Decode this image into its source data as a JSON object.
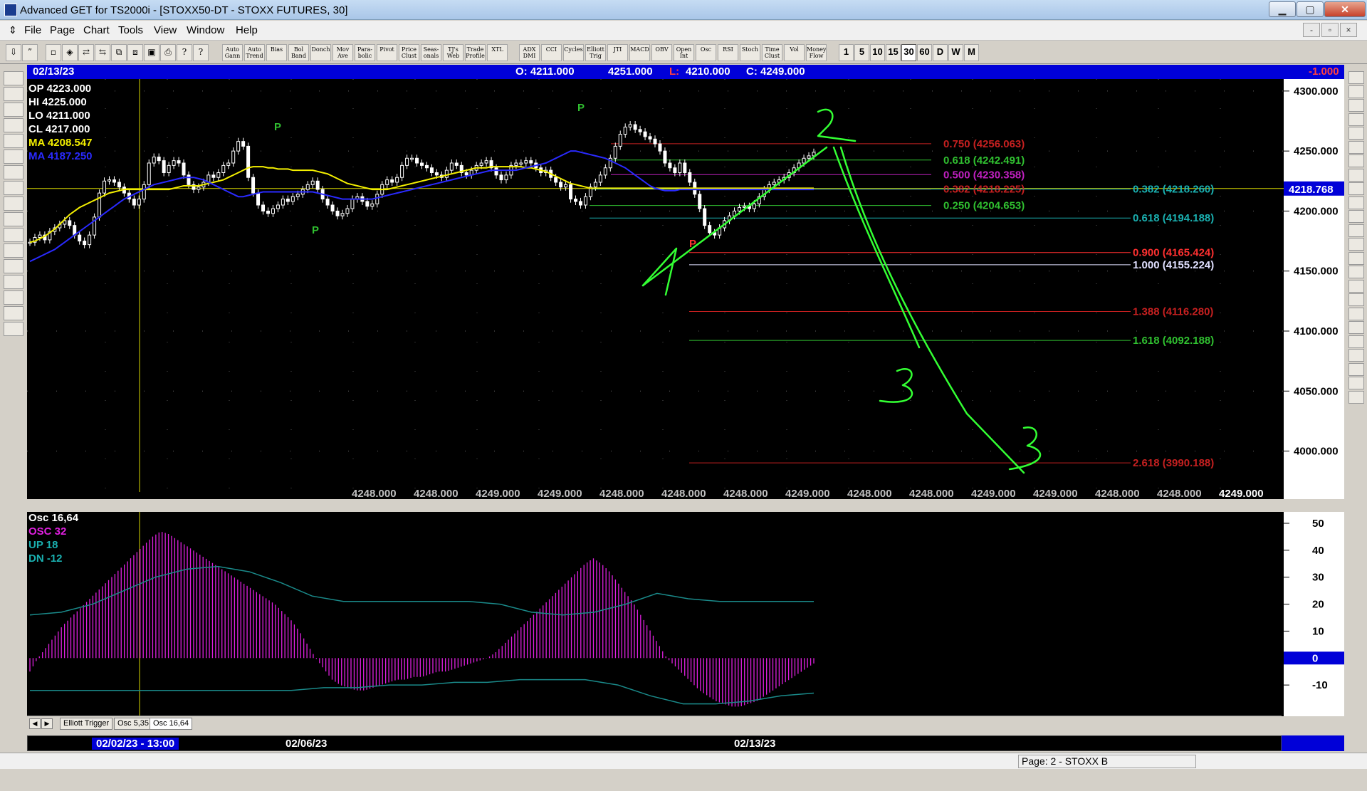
{
  "window": {
    "title": "Advanced GET for TS2000i - [STOXX50-DT - STOXX FUTURES, 30]",
    "minimize": "▁",
    "maximize": "▢",
    "close": "✕"
  },
  "menu": {
    "items": [
      "File",
      "Page",
      "Chart",
      "Tools",
      "View",
      "Window",
      "Help"
    ],
    "mdi_buttons": [
      "-",
      "▫",
      "×"
    ]
  },
  "toolbar": {
    "studies": [
      "Auto\nGann",
      "Auto\nTrend",
      "Bias",
      "Bol\nBand",
      "Donch",
      "Mov\nAve",
      "Para-\nbolic",
      "Pivot",
      "Price\nClust",
      "Seas-\nonals",
      "TJ's\nWeb",
      "Trade\nProfile",
      "XTL",
      "ADX\nDMI",
      "CCI",
      "Cycles",
      "Elliott\nTrig",
      "JTI",
      "MACD",
      "OBV",
      "Open\nInt",
      "Osc",
      "RSI",
      "Stoch",
      "Time\nClust",
      "Vol",
      "Money\nFlow"
    ],
    "timeframes": [
      "1",
      "5",
      "10",
      "15",
      "30",
      "60",
      "D",
      "W",
      "M"
    ],
    "active_timeframe": "30"
  },
  "infobar": {
    "date": "02/13/23",
    "open": "O: 4211.000",
    "high": "4251.000",
    "low_label": "L:",
    "low": "4210.000",
    "close": "C: 4249.000",
    "change": "-1.000"
  },
  "legend": {
    "op": "OP  4223.000",
    "hi": "HI   4225.000",
    "lo": "LO  4211.000",
    "cl": "CL  4217.000",
    "ma1": "MA  4208.547",
    "ma2": "MA  4187.250"
  },
  "colors": {
    "background": "#000000",
    "candle": "#ffffff",
    "ma_yellow": "#f4f000",
    "ma_blue": "#2a2aff",
    "oscillator": "#e020e0",
    "osc_band": "#1a8a8a",
    "drawing": "#33ff33",
    "accent_blue": "#0000d8"
  },
  "fib_levels": [
    {
      "label": "0.750 (4256.063)",
      "color": "#c62020",
      "price": 4256.063
    },
    {
      "label": "0.618 (4242.491)",
      "color": "#30c030",
      "price": 4242.491
    },
    {
      "label": "0.500 (4230.358)",
      "color": "#c020c0",
      "price": 4230.358
    },
    {
      "label": "0.382 (4218.225)",
      "color": "#c62020",
      "price": 4218.225
    },
    {
      "label": "0.250 (4204.653)",
      "color": "#30c030",
      "price": 4204.653
    },
    {
      "label": "0.382 (4218.260)",
      "color": "#1ab0b0",
      "price": 4218.26
    },
    {
      "label": "0.618 (4194.188)",
      "color": "#1ab0b0",
      "price": 4194.188
    },
    {
      "label": "0.900 (4165.424)",
      "color": "#ff3030",
      "price": 4165.424
    },
    {
      "label": "1.000 (4155.224)",
      "color": "#e0e0ff",
      "price": 4155.224
    },
    {
      "label": "1.388 (4116.280)",
      "color": "#c62020",
      "price": 4116.28
    },
    {
      "label": "1.618 (4092.188)",
      "color": "#30c030",
      "price": 4092.188
    },
    {
      "label": "2.618 (3990.188)",
      "color": "#c62020",
      "price": 3990.188
    }
  ],
  "price_axis": {
    "ticks": [
      "4300.000",
      "4250.000",
      "4200.000",
      "4150.000",
      "4100.000",
      "4050.000",
      "4000.000"
    ],
    "current": "4218.768"
  },
  "bottom_readout": [
    "4248.000",
    "4248.000",
    "4249.000",
    "4249.000",
    "4248.000",
    "4248.000",
    "4248.000",
    "4249.000",
    "4248.000",
    "4248.000",
    "4249.000",
    "4249.000",
    "4248.000",
    "4248.000",
    "4249.000"
  ],
  "pivot_labels": [
    "P",
    "P",
    "P",
    "P"
  ],
  "oscillator": {
    "title": "Osc 16,64",
    "osc": "OSC 32",
    "up": "UP    18",
    "dn": "DN   -12",
    "ticks": [
      "50",
      "40",
      "30",
      "20",
      "10",
      "0",
      "-10"
    ],
    "zero_label": "0"
  },
  "annotations": [
    "1",
    "2",
    "3",
    "3"
  ],
  "tabs": [
    "Elliott Trigger",
    "Osc 5,35",
    "Osc 16,64"
  ],
  "tab_nav": [
    "◀",
    "▶"
  ],
  "dates": {
    "selected": "02/02/23 - 13:00",
    "d2": "02/06/23",
    "d3": "02/13/23"
  },
  "status": {
    "page": "Page: 2 - STOXX B"
  },
  "chart_data": {
    "type": "line",
    "title": "",
    "xlabel": "",
    "ylabel": "",
    "ylim": [
      3960,
      4310
    ],
    "series": [
      {
        "name": "",
        "values": [
          4174,
          4178,
          4180,
          4176,
          4183,
          4186,
          4189,
          4192,
          4188,
          4180,
          4175,
          4172,
          4180,
          4195,
          4215,
          4225,
          4226,
          4224,
          4220,
          4215,
          4210,
          4205,
          4210,
          4222,
          4240,
          4245,
          4242,
          4232,
          4238,
          4242,
          4240,
          4230,
          4222,
          4218,
          4220,
          4224,
          4230,
          4228,
          4232,
          4238,
          4240,
          4250,
          4258,
          4254,
          4228,
          4215,
          4205,
          4200,
          4198,
          4202,
          4205,
          4210,
          4208,
          4212,
          4214,
          4218,
          4222,
          4225,
          4218,
          4210,
          4205,
          4200,
          4196,
          4198,
          4202,
          4210,
          4212,
          4208,
          4204,
          4206,
          4214,
          4222,
          4226,
          4224,
          4228,
          4238,
          4244,
          4244,
          4240,
          4238,
          4236,
          4232,
          4230,
          4228,
          4234,
          4240,
          4238,
          4232,
          4230,
          4234,
          4238,
          4240,
          4242,
          4236,
          4230,
          4226,
          4230,
          4238,
          4240,
          4240,
          4242,
          4240,
          4236,
          4232,
          4234,
          4228,
          4224,
          4220,
          4222,
          4210,
          4208,
          4205,
          4212,
          4220,
          4224,
          4230,
          4236,
          4244,
          4254,
          4264,
          4270,
          4272,
          4268,
          4266,
          4262,
          4260,
          4256,
          4250,
          4240,
          4236,
          4232,
          4240,
          4232,
          4224,
          4214,
          4202,
          4188,
          4182,
          4180,
          4186,
          4192,
          4196,
          4200,
          4203,
          4204,
          4202,
          4206,
          4212,
          4218,
          4222,
          4224,
          4226,
          4228,
          4232,
          4236,
          4240,
          4244,
          4246,
          4249
        ]
      }
    ],
    "ma_yellow": [
      4174,
      4175,
      4177,
      4179,
      4182,
      4185,
      4189,
      4193,
      4197,
      4200,
      4203,
      4205,
      4207,
      4209,
      4211,
      4213,
      4215,
      4216,
      4217,
      4218,
      4218,
      4218,
      4218,
      4218,
      4218,
      4218,
      4218,
      4218,
      4218,
      4219,
      4220,
      4221,
      4221,
      4221,
      4221,
      4222,
      4223,
      4224,
      4225,
      4226,
      4228,
      4230,
      4232,
      4234,
      4236,
      4237,
      4237,
      4237,
      4236,
      4236,
      4235,
      4235,
      4235,
      4234,
      4234,
      4234,
      4234,
      4234,
      4233,
      4232,
      4231,
      4229,
      4227,
      4225,
      4223,
      4222,
      4221,
      4220,
      4219,
      4218,
      4218,
      4218,
      4218,
      4219,
      4220,
      4221,
      4222,
      4223,
      4224,
      4225,
      4226,
      4227,
      4228,
      4229,
      4230,
      4231,
      4232,
      4233,
      4234,
      4235,
      4236,
      4236,
      4236,
      4237,
      4237,
      4237,
      4237,
      4237,
      4237,
      4237,
      4236,
      4236,
      4235,
      4234,
      4233,
      4231,
      4229,
      4227,
      4225,
      4223,
      4222,
      4221,
      4220,
      4219,
      4219,
      4219,
      4219,
      4219,
      4219,
      4219,
      4219,
      4219,
      4219,
      4219,
      4219,
      4219,
      4219,
      4219,
      4219,
      4219,
      4219,
      4219,
      4219,
      4219,
      4219,
      4219,
      4219,
      4219,
      4219,
      4219,
      4219,
      4219,
      4219,
      4219,
      4219,
      4219,
      4219,
      4219,
      4219,
      4219,
      4219,
      4219,
      4219,
      4219,
      4219,
      4219,
      4219,
      4219,
      4219
    ],
    "ma_blue": [
      4158,
      4160,
      4162,
      4164,
      4166,
      4168,
      4171,
      4174,
      4177,
      4180,
      4183,
      4186,
      4189,
      4192,
      4195,
      4198,
      4201,
      4204,
      4207,
      4210,
      4212,
      4214,
      4216,
      4218,
      4220,
      4222,
      4223,
      4224,
      4225,
      4226,
      4227,
      4228,
      4228,
      4228,
      4227,
      4226,
      4224,
      4222,
      4220,
      4218,
      4216,
      4214,
      4212,
      4212,
      4213,
      4214,
      4215,
      4216,
      4216,
      4216,
      4216,
      4216,
      4216,
      4216,
      4216,
      4216,
      4216,
      4216,
      4215,
      4214,
      4213,
      4212,
      4211,
      4210,
      4210,
      4210,
      4210,
      4210,
      4210,
      4210,
      4211,
      4212,
      4213,
      4214,
      4215,
      4216,
      4217,
      4218,
      4219,
      4220,
      4221,
      4222,
      4223,
      4224,
      4225,
      4226,
      4227,
      4228,
      4229,
      4230,
      4231,
      4232,
      4233,
      4234,
      4234,
      4234,
      4234,
      4234,
      4234,
      4235,
      4236,
      4237,
      4238,
      4239,
      4240,
      4242,
      4244,
      4246,
      4248,
      4250,
      4250,
      4249,
      4248,
      4247,
      4246,
      4245,
      4244,
      4242,
      4240,
      4238,
      4236,
      4233,
      4230,
      4227,
      4224,
      4221,
      4219,
      4218,
      4217,
      4217,
      4217,
      4218,
      4218,
      4218,
      4218,
      4218,
      4218,
      4218,
      4218,
      4218,
      4218,
      4218,
      4218,
      4218,
      4218,
      4218,
      4218,
      4218,
      4218,
      4218,
      4218,
      4218,
      4218,
      4218,
      4218,
      4218,
      4218,
      4218,
      4218
    ],
    "osc_values": [
      -5,
      0,
      4,
      8,
      12,
      15,
      18,
      21,
      24,
      27,
      30,
      33,
      36,
      39,
      42,
      45,
      47,
      46,
      44,
      42,
      40,
      38,
      36,
      34,
      32,
      30,
      28,
      26,
      24,
      22,
      20,
      17,
      14,
      10,
      5,
      0,
      -4,
      -8,
      -10,
      -11,
      -12,
      -12,
      -11,
      -10,
      -9,
      -8,
      -8,
      -7,
      -7,
      -6,
      -5,
      -5,
      -4,
      -3,
      -2,
      -1,
      0,
      2,
      5,
      8,
      11,
      14,
      17,
      20,
      23,
      26,
      29,
      32,
      35,
      37,
      35,
      32,
      28,
      24,
      20,
      15,
      10,
      5,
      0,
      -3,
      -6,
      -9,
      -12,
      -14,
      -16,
      -17,
      -18,
      -18,
      -17,
      -16,
      -14,
      -12,
      -10,
      -8,
      -6,
      -4,
      -2
    ]
  }
}
